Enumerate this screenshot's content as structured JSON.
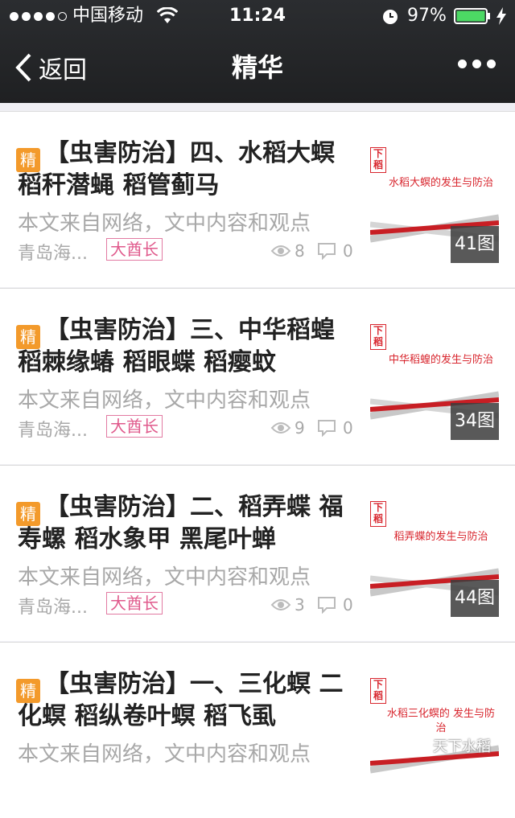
{
  "status_bar": {
    "carrier": "中国移动",
    "time": "11:24",
    "battery": "97%",
    "signal_bars_filled": 4,
    "signal_bars_total": 5
  },
  "nav": {
    "back_label": "返回",
    "title": "精华"
  },
  "articles": [
    {
      "badge": "精",
      "title": "【虫害防治】四、水稻大螟 稻秆潜蝇 稻管蓟马",
      "desc": "本文来自网络，文中内容和观点",
      "author": "青岛海...",
      "tag": "大酋长",
      "views": "8",
      "comments": "0",
      "thumb_logo": "下稻",
      "thumb_caption": "水稻大螟的发生与防治",
      "image_count": "41图"
    },
    {
      "badge": "精",
      "title": "【虫害防治】三、中华稻蝗 稻棘缘蝽 稻眼蝶 稻瘿蚊",
      "desc": "本文来自网络，文中内容和观点",
      "author": "青岛海...",
      "tag": "大酋长",
      "views": "9",
      "comments": "0",
      "thumb_logo": "下稻",
      "thumb_caption": "中华稻蝗的发生与防治",
      "image_count": "34图"
    },
    {
      "badge": "精",
      "title": "【虫害防治】二、稻弄蝶 福寿螺 稻水象甲 黑尾叶蝉",
      "desc": "本文来自网络，文中内容和观点",
      "author": "青岛海...",
      "tag": "大酋长",
      "views": "3",
      "comments": "0",
      "thumb_logo": "下稻",
      "thumb_caption": "稻弄蝶的发生与防治",
      "image_count": "44图"
    },
    {
      "badge": "精",
      "title": "【虫害防治】一、三化螟 二化螟 稻纵卷叶螟 稻飞虱",
      "desc": "本文来自网络，文中内容和观点",
      "author": "",
      "tag": "",
      "views": "",
      "comments": "",
      "thumb_logo": "下稻",
      "thumb_caption": "水稻三化螟的 发生与防治",
      "image_count": ""
    }
  ],
  "watermark": "天下水稻",
  "colors": {
    "badge": "#f39a2b",
    "tag_border": "#e27aa2",
    "thumb_red": "#d8262e",
    "nav_bg": "#1f2022"
  }
}
